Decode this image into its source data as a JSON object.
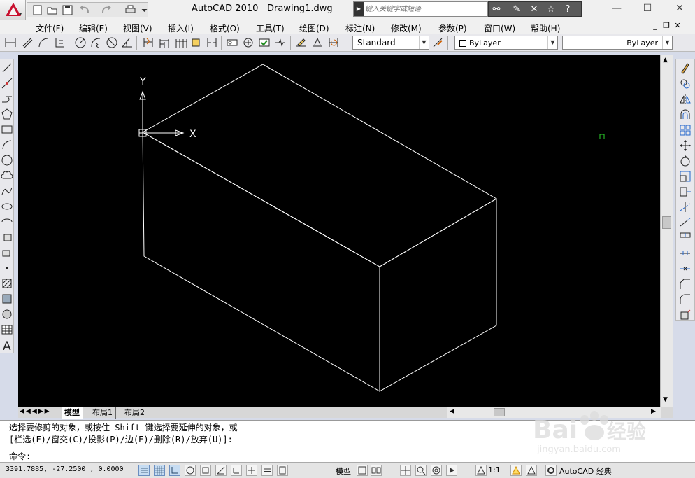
{
  "title_bar": {
    "app_title": "AutoCAD 2010",
    "doc_title": "Drawing1.dwg",
    "search_placeholder": "键入关键字或短语"
  },
  "menus": [
    "文件(F)",
    "编辑(E)",
    "视图(V)",
    "插入(I)",
    "格式(O)",
    "工具(T)",
    "绘图(D)",
    "标注(N)",
    "修改(M)",
    "参数(P)",
    "窗口(W)",
    "帮助(H)"
  ],
  "toolbar": {
    "text_style": "Standard",
    "layer": "ByLayer",
    "linetype": "ByLayer"
  },
  "viewport": {
    "ucs_y_label": "Y",
    "ucs_x_label": "X",
    "background": "#000000",
    "line_color": "#ffffff"
  },
  "layout_tabs": [
    "模型",
    "布局1",
    "布局2"
  ],
  "command": {
    "line1": "选择要修剪的对象，或按住 Shift 键选择要延伸的对象，或",
    "line2": "[栏选(F)/窗交(C)/投影(P)/边(E)/删除(R)/放弃(U)]:",
    "prompt": "命令:"
  },
  "status": {
    "coords": "3391.7885, -27.2500  , 0.0000",
    "model_label": "模型",
    "scale": "1:1",
    "workspace": "AutoCAD 经典"
  },
  "watermark": {
    "brand": "Bai",
    "brand_cn": "经验",
    "url": "jingyan.baidu.com"
  }
}
